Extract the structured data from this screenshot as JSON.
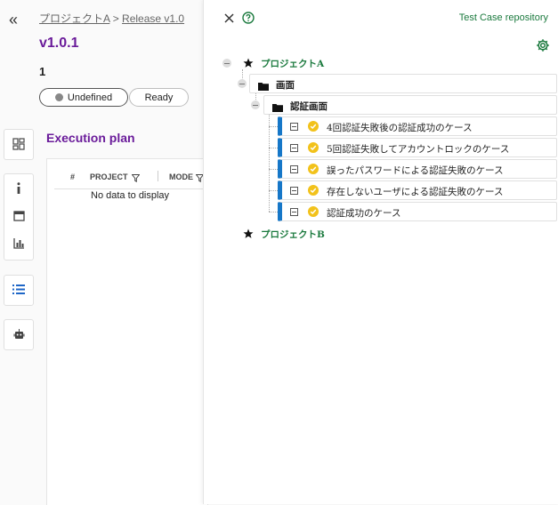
{
  "breadcrumb": {
    "project": "プロジェクトA",
    "separator": ">",
    "release": "Release v1.0"
  },
  "release": {
    "version": "v1.0.1",
    "count": "1"
  },
  "status_pills": {
    "undefined": "Undefined",
    "ready": "Ready"
  },
  "execution_plan": {
    "title": "Execution plan",
    "columns": {
      "index": "#",
      "project": "PROJECT",
      "mode": "MODE"
    },
    "empty_text": "No data to display"
  },
  "repository": {
    "title": "Test Case repository",
    "projects": [
      {
        "name": "プロジェクトA"
      },
      {
        "name": "プロジェクトB"
      }
    ],
    "folders": [
      {
        "name": "画面"
      },
      {
        "name": "認証画面"
      }
    ],
    "cases": [
      {
        "name": "4回認証失敗後の認証成功のケース"
      },
      {
        "name": "5回認証失敗してアカウントロックのケース"
      },
      {
        "name": "誤ったパスワードによる認証失敗のケース"
      },
      {
        "name": "存在しないユーザによる認証失敗のケース"
      },
      {
        "name": "認証成功のケース"
      }
    ]
  },
  "colors": {
    "accent_purple": "#6a1b9a",
    "accent_green": "#1b7a3e",
    "case_bar_blue": "#1677c8",
    "check_yellow": "#f2c21b"
  },
  "icons": [
    "double-chevron-left-icon",
    "dashboard-icon",
    "info-icon",
    "calendar-icon",
    "bar-chart-icon",
    "list-icon",
    "robot-icon",
    "close-icon",
    "help-icon",
    "gear-icon",
    "star-icon",
    "folder-icon",
    "collapse-minus-icon",
    "check-circle-icon"
  ]
}
